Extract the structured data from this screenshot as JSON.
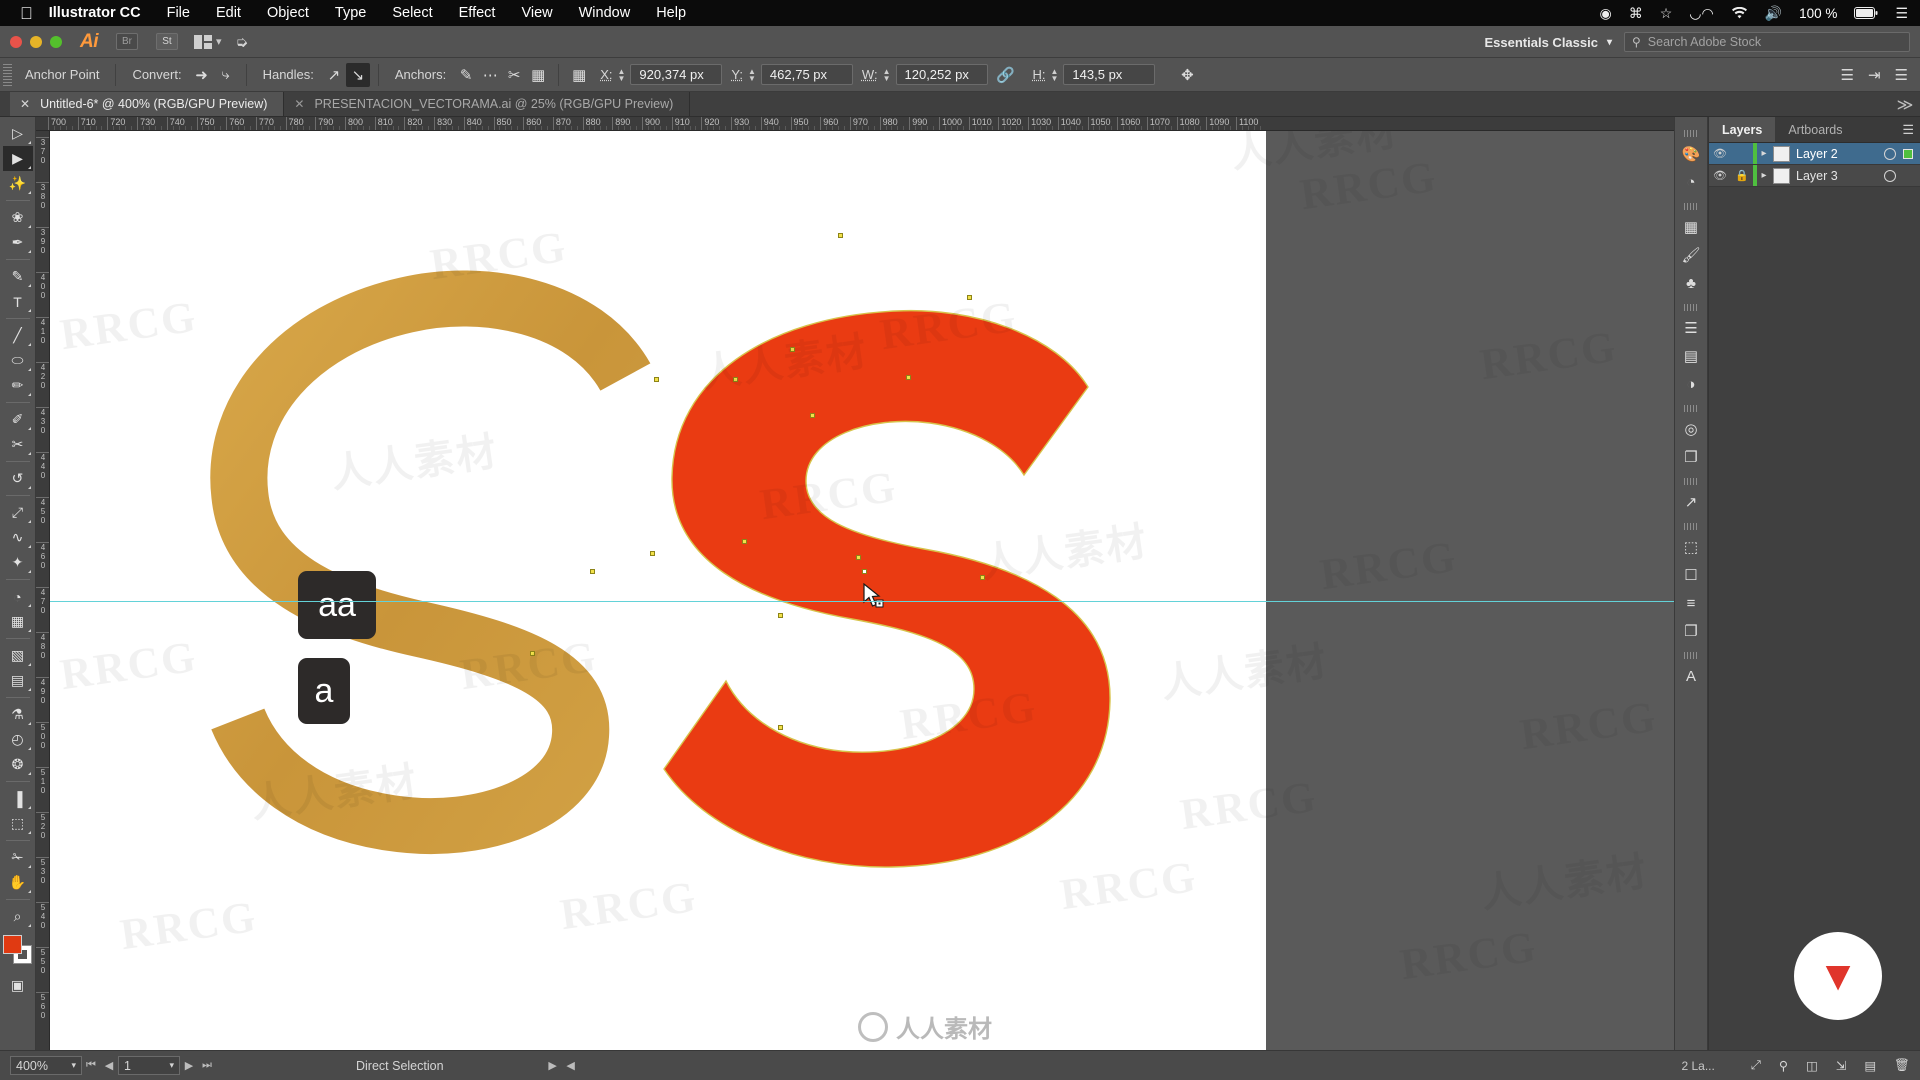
{
  "macbar": {
    "apple_icon": "",
    "app_name": "Illustrator CC",
    "menus": [
      "File",
      "Edit",
      "Object",
      "Type",
      "Select",
      "Effect",
      "View",
      "Window",
      "Help"
    ],
    "status_icons": [
      "record-icon",
      "command-icon",
      "bookmark-icon",
      "creative-cloud-icon",
      "wifi-icon",
      "volume-icon"
    ],
    "battery_percent": "100 %"
  },
  "titlebar": {
    "ai_logo": "Ai",
    "bridge_badge": "Br",
    "stock_badge": "St",
    "workspace": "Essentials Classic",
    "search_placeholder": "Search Adobe Stock"
  },
  "controlbar": {
    "selection_label": "Anchor Point",
    "convert_label": "Convert:",
    "handles_label": "Handles:",
    "anchors_label": "Anchors:",
    "x_label": "X:",
    "x_value": "920,374 px",
    "y_label": "Y:",
    "y_value": "462,75 px",
    "w_label": "W:",
    "w_value": "120,252 px",
    "h_label": "H:",
    "h_value": "143,5 px"
  },
  "doctabs": [
    {
      "title": "Untitled-6* @ 400% (RGB/GPU Preview)",
      "active": true
    },
    {
      "title": "PRESENTACION_VECTORAMA.ai @ 25% (RGB/GPU Preview)",
      "active": false
    }
  ],
  "tools": [
    {
      "name": "selection-tool",
      "glyph": "▷",
      "active": false
    },
    {
      "name": "direct-selection-tool",
      "glyph": "▶",
      "active": true
    },
    {
      "name": "magic-wand-tool",
      "glyph": "✨",
      "active": false
    },
    {
      "name": "lasso-tool",
      "glyph": "❀",
      "active": false
    },
    {
      "name": "pen-tool",
      "glyph": "✒",
      "active": false
    },
    {
      "name": "curvature-tool",
      "glyph": "✎",
      "active": false
    },
    {
      "name": "type-tool",
      "glyph": "T",
      "active": false
    },
    {
      "name": "line-segment-tool",
      "glyph": "╱",
      "active": false
    },
    {
      "name": "ellipse-tool",
      "glyph": "⬭",
      "active": false
    },
    {
      "name": "paintbrush-tool",
      "glyph": "✏",
      "active": false
    },
    {
      "name": "pencil-tool",
      "glyph": "✐",
      "active": false
    },
    {
      "name": "scissors-tool",
      "glyph": "✂",
      "active": false
    },
    {
      "name": "rotate-tool",
      "glyph": "↺",
      "active": false
    },
    {
      "name": "scale-tool",
      "glyph": "⤢",
      "active": false
    },
    {
      "name": "width-tool",
      "glyph": "∿",
      "active": false
    },
    {
      "name": "free-transform-tool",
      "glyph": "✦",
      "active": false
    },
    {
      "name": "shape-builder-tool",
      "glyph": "◔",
      "active": false
    },
    {
      "name": "perspective-grid-tool",
      "glyph": "▦",
      "active": false
    },
    {
      "name": "mesh-tool",
      "glyph": "▧",
      "active": false
    },
    {
      "name": "gradient-tool",
      "glyph": "▤",
      "active": false
    },
    {
      "name": "eyedropper-tool",
      "glyph": "⚗",
      "active": false
    },
    {
      "name": "blend-tool",
      "glyph": "◴",
      "active": false
    },
    {
      "name": "symbol-sprayer-tool",
      "glyph": "❂",
      "active": false
    },
    {
      "name": "column-graph-tool",
      "glyph": "▐",
      "active": false
    },
    {
      "name": "artboard-tool",
      "glyph": "⬚",
      "active": false
    },
    {
      "name": "slice-tool",
      "glyph": "✁",
      "active": false
    },
    {
      "name": "hand-tool",
      "glyph": "✋",
      "active": false
    },
    {
      "name": "zoom-tool",
      "glyph": "⌕",
      "active": false
    }
  ],
  "swatches": {
    "fill_color": "#e03a12",
    "stroke_color": "#ffffff"
  },
  "rulers": {
    "h_start": 700,
    "h_step": 10,
    "h_count": 41,
    "v_labels": [
      "370",
      "380",
      "390",
      "400",
      "410",
      "420",
      "430",
      "440",
      "450",
      "460",
      "470",
      "480",
      "490",
      "500",
      "510",
      "520",
      "530",
      "540",
      "550",
      "560"
    ]
  },
  "canvas": {
    "guide_color": "#63d2d8",
    "letter_left": {
      "name": "letter-s-gold",
      "char": "S",
      "color": "#cf9c3a"
    },
    "letter_right": {
      "name": "letter-s-red",
      "char": "S",
      "color": "#ea3b12"
    },
    "badges": [
      {
        "name": "badge-aa",
        "text": "aa"
      },
      {
        "name": "badge-a",
        "text": "a"
      }
    ]
  },
  "dock_icons": [
    "color-panel-icon",
    "color-guide-icon",
    "swatches-icon",
    "brushes-icon",
    "symbols-icon",
    "stroke-icon",
    "gradient-icon",
    "transparency-icon",
    "appearance-icon",
    "pathfinder-icon",
    "export-icon",
    "transform-icon",
    "3d-icon",
    "align-icon",
    "layers-stack-icon",
    "type-panel-icon"
  ],
  "layers_panel": {
    "tabs": [
      {
        "label": "Layers",
        "active": true
      },
      {
        "label": "Artboards",
        "active": false
      }
    ],
    "rows": [
      {
        "name": "Layer 2",
        "selected": true,
        "locked": false,
        "visible": true
      },
      {
        "name": "Layer 3",
        "selected": false,
        "locked": true,
        "visible": true
      }
    ],
    "footer_count": "2 La..."
  },
  "statusbar": {
    "zoom": "400%",
    "page": "1",
    "tool_status": "Direct Selection",
    "footer_icons": [
      "new-window-icon",
      "search-icon",
      "duplicate-icon",
      "new-sublayer-icon",
      "new-layer-icon",
      "delete-icon"
    ]
  },
  "watermarks": {
    "text": "RRCG",
    "cn_text": "人人素材",
    "bottom_text": "人人素材"
  }
}
